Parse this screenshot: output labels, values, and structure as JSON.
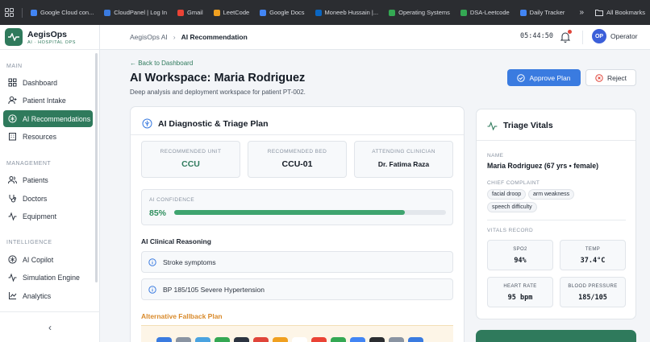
{
  "bookmarks": [
    {
      "label": "Google Cloud con...",
      "color": "#4285f4"
    },
    {
      "label": "CloudPanel | Log In",
      "color": "#3a7be0"
    },
    {
      "label": "Gmail",
      "color": "#ea4335"
    },
    {
      "label": "LeetCode",
      "color": "#f0a020"
    },
    {
      "label": "Google Docs",
      "color": "#4285f4"
    },
    {
      "label": "Moneeb Hussain |...",
      "color": "#0a66c2"
    },
    {
      "label": "Operating Systems",
      "color": "#34a853"
    },
    {
      "label": "DSA-Leetcode",
      "color": "#34a853"
    },
    {
      "label": "Daily Tracker",
      "color": "#4285f4"
    }
  ],
  "bookmarks_overflow": "»",
  "all_bookmarks": "All Bookmarks",
  "brand": {
    "name": "AegisOps",
    "sub": "AI · HOSPITAL OPS"
  },
  "sidebar": {
    "sections": [
      {
        "title": "MAIN",
        "items": [
          {
            "label": "Dashboard",
            "icon": "grid-icon",
            "active": false
          },
          {
            "label": "Patient Intake",
            "icon": "user-plus-icon",
            "active": false
          },
          {
            "label": "AI Recommendations",
            "icon": "compass-icon",
            "active": true
          },
          {
            "label": "Resources",
            "icon": "building-icon",
            "active": false
          }
        ]
      },
      {
        "title": "MANAGEMENT",
        "items": [
          {
            "label": "Patients",
            "icon": "users-icon",
            "active": false
          },
          {
            "label": "Doctors",
            "icon": "stethoscope-icon",
            "active": false
          },
          {
            "label": "Equipment",
            "icon": "activity-icon",
            "active": false
          }
        ]
      },
      {
        "title": "INTELLIGENCE",
        "items": [
          {
            "label": "AI Copilot",
            "icon": "compass-icon",
            "active": false
          },
          {
            "label": "Simulation Engine",
            "icon": "activity-icon",
            "active": false
          },
          {
            "label": "Analytics",
            "icon": "chart-icon",
            "active": false
          }
        ]
      }
    ],
    "collapse_glyph": "‹"
  },
  "topbar": {
    "crumb_root": "AegisOps AI",
    "crumb_sep": "›",
    "crumb_current": "AI Recommendation",
    "clock": "05:44:50",
    "avatar_initials": "OP",
    "user": "Operator"
  },
  "page": {
    "back": "← Back to Dashboard",
    "title": "AI Workspace: Maria Rodriguez",
    "subtitle": "Deep analysis and deployment workspace for patient PT-002.",
    "approve": "Approve Plan",
    "reject": "Reject"
  },
  "plan": {
    "title": "AI Diagnostic & Triage Plan",
    "unit_label": "RECOMMENDED UNIT",
    "unit": "CCU",
    "bed_label": "RECOMMENDED BED",
    "bed": "CCU-01",
    "clinician_label": "ATTENDING CLINICIAN",
    "clinician": "Dr. Fatima Raza",
    "confidence_label": "AI CONFIDENCE",
    "confidence_text": "85%",
    "confidence": 0.85,
    "reasoning_title": "AI Clinical Reasoning",
    "reasons": [
      "Stroke symptoms",
      "BP 185/105 Severe Hypertension"
    ],
    "fallback_title": "Alternative Fallback Plan"
  },
  "vitals": {
    "title": "Triage Vitals",
    "name_label": "NAME",
    "name": "Maria Rodriguez (67 yrs • female)",
    "complaint_label": "CHIEF COMPLAINT",
    "complaints": [
      "facial droop",
      "arm weakness",
      "speech difficulty"
    ],
    "record_label": "VITALS RECORD",
    "spo2_label": "SPO2",
    "spo2": "94%",
    "temp_label": "TEMP",
    "temp": "37.4°C",
    "hr_label": "HEART RATE",
    "hr": "95 bpm",
    "bp_label": "BLOOD PRESSURE",
    "bp": "185/105"
  },
  "colors": {
    "accent": "#2f7a5c",
    "primary": "#3a7be0",
    "warning": "#d98a2b",
    "alert": "#e0453a"
  }
}
